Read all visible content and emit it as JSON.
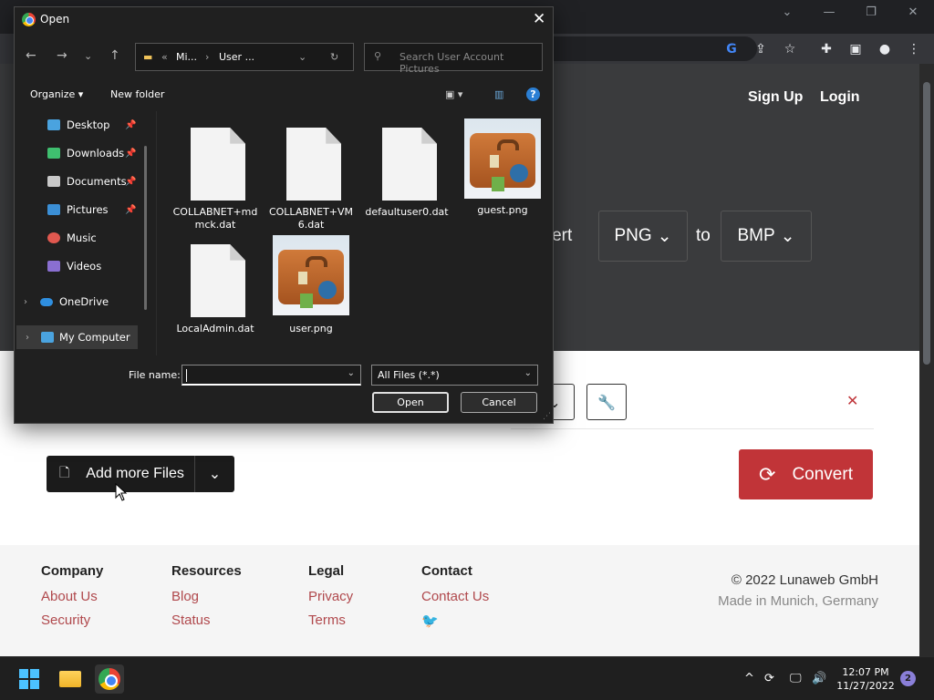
{
  "dialog": {
    "title": "Open",
    "path_overflow": "«",
    "path_seg1": "Mi...",
    "path_sep": "›",
    "path_seg2": "User ...",
    "search_placeholder": "Search User Account Pictures",
    "organize_label": "Organize ▾",
    "new_folder_label": "New folder",
    "sidebar": [
      {
        "label": "Desktop",
        "icon": "desktop-icon",
        "color": "#4aa3df",
        "pinned": true
      },
      {
        "label": "Downloads",
        "icon": "download-icon",
        "color": "#3fbf6f",
        "pinned": true
      },
      {
        "label": "Documents",
        "icon": "documents-icon",
        "color": "#c9c9c9",
        "pinned": true
      },
      {
        "label": "Pictures",
        "icon": "pictures-icon",
        "color": "#3b8fd6",
        "pinned": true
      },
      {
        "label": "Music",
        "icon": "music-icon",
        "color": "#e0584f",
        "pinned": false
      },
      {
        "label": "Videos",
        "icon": "videos-icon",
        "color": "#8a6fd1",
        "pinned": false
      },
      {
        "label": "OneDrive",
        "icon": "onedrive-icon",
        "color": "#2f8fe0",
        "pinned": false
      },
      {
        "label": "My Computer",
        "icon": "computer-icon",
        "color": "#4aa3df",
        "pinned": false
      }
    ],
    "files": [
      {
        "name_line1": "COLLABNET+md",
        "name_line2": "mck.dat",
        "kind": "doc"
      },
      {
        "name_line1": "COLLABNET+VM",
        "name_line2": "6.dat",
        "kind": "doc"
      },
      {
        "name_line1": "defaultuser0.dat",
        "name_line2": "",
        "kind": "doc"
      },
      {
        "name_line1": "guest.png",
        "name_line2": "",
        "kind": "image"
      },
      {
        "name_line1": "LocalAdmin.dat",
        "name_line2": "",
        "kind": "doc"
      },
      {
        "name_line1": "user.png",
        "name_line2": "",
        "kind": "image"
      }
    ],
    "file_name_label": "File name:",
    "file_name_value": "",
    "filter_value": "All Files (*.*)",
    "open_label": "Open",
    "cancel_label": "Cancel"
  },
  "site": {
    "signup": "Sign Up",
    "login": "Login",
    "convert_text": "nvert",
    "from_format": "PNG",
    "to_text": "to",
    "to_format": "BMP",
    "add_files_label": "Add more Files",
    "convert_label": "Convert",
    "accent_color": "#c13438",
    "footer": {
      "company": {
        "heading": "Company",
        "links": [
          "About Us",
          "Security"
        ]
      },
      "resources": {
        "heading": "Resources",
        "links": [
          "Blog",
          "Status"
        ]
      },
      "legal": {
        "heading": "Legal",
        "links": [
          "Privacy",
          "Terms"
        ]
      },
      "contact": {
        "heading": "Contact",
        "links": [
          "Contact Us"
        ]
      },
      "copyright": "© 2022 Lunaweb GmbH",
      "made_in": "Made in Munich, Germany"
    }
  },
  "taskbar": {
    "time": "12:07 PM",
    "date": "11/27/2022",
    "notification_count": "2"
  }
}
